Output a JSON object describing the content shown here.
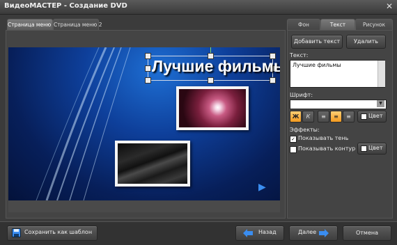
{
  "window": {
    "title": "ВидеоМАСТЕР - Создание DVD",
    "close_glyph": "✕"
  },
  "left_tabs": [
    {
      "label": "Страница меню 1",
      "active": true
    },
    {
      "label": "Страница меню 2",
      "active": false
    }
  ],
  "right_tabs": [
    {
      "label": "Фон",
      "active": false
    },
    {
      "label": "Текст",
      "active": true
    },
    {
      "label": "Рисунок",
      "active": false
    }
  ],
  "preview": {
    "title_text": "Лучшие фильмы",
    "next_glyph": "▶"
  },
  "text_panel": {
    "add_text_label": "Добавить текст",
    "delete_label": "Удалить",
    "text_label": "Текст:",
    "text_value": "Лучшие фильмы",
    "font_label": "Шрифт:",
    "font_value": "",
    "format_buttons": [
      {
        "glyph": "Ж",
        "name": "bold",
        "active": true
      },
      {
        "glyph": "К",
        "name": "italic",
        "active": false
      },
      {
        "glyph": "≡",
        "name": "align-left",
        "active": false
      },
      {
        "glyph": "≡",
        "name": "align-center",
        "active": true
      },
      {
        "glyph": "≡",
        "name": "align-right",
        "active": false
      }
    ],
    "color_label": "Цвет",
    "effects_label": "Эффекты:",
    "show_shadow_label": "Показывать тень",
    "show_shadow_checked": true,
    "show_outline_label": "Показывать контур",
    "show_outline_checked": false,
    "outline_color_label": "Цвет"
  },
  "footer": {
    "save_template_label": "Сохранить как шаблон",
    "back_label": "Назад",
    "next_label": "Далее",
    "cancel_label": "Отмена"
  },
  "colors": {
    "accent_orange": "#f39a1f",
    "arrow_blue": "#3a8df0",
    "bg": "#3b3b3b"
  }
}
